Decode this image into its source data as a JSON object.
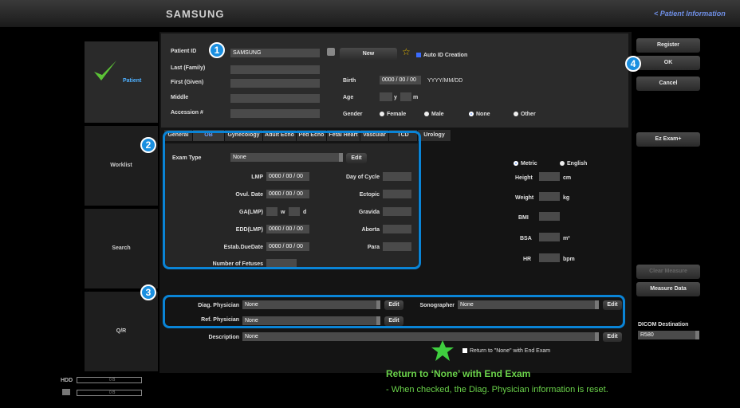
{
  "app": {
    "brand": "SAMSUNG",
    "back_link": "< Patient Information"
  },
  "sidebar": {
    "items": [
      {
        "label": "Patient"
      },
      {
        "label": "Worklist"
      },
      {
        "label": "Search"
      },
      {
        "label": "Q/R"
      }
    ]
  },
  "patient": {
    "labels": {
      "patient_id": "Patient ID",
      "last": "Last (Family)",
      "first": "First (Given)",
      "middle": "Middle",
      "accession": "Accession #",
      "birth": "Birth",
      "age": "Age",
      "gender": "Gender",
      "auto_id": "Auto ID Creation"
    },
    "patient_id_value": "SAMSUNG",
    "new_label": "New",
    "birth": {
      "yyyy": "0000",
      "mm": "00",
      "dd": "00",
      "sep": "/",
      "format": "YYYY/MM/DD"
    },
    "age_units": {
      "y": "y",
      "m": "m"
    },
    "genders": [
      "Female",
      "Male",
      "None",
      "Other"
    ]
  },
  "right_buttons": {
    "register": "Register",
    "ok": "OK",
    "cancel": "Cancel",
    "ez_exam": "Ez Exam+",
    "clear_measure": "Clear Measure",
    "measure_data": "Measure Data",
    "dicom_destination_label": "DICOM Destination",
    "dicom_destination_value": "R580"
  },
  "tabs": [
    {
      "label": "General"
    },
    {
      "label": "OB"
    },
    {
      "label": "Gynecology"
    },
    {
      "label": "Adult Echo"
    },
    {
      "label": "Ped Echo"
    },
    {
      "label": "Fetal Heart"
    },
    {
      "label": "Vascular"
    },
    {
      "label": "TCD"
    },
    {
      "label": "Urology"
    }
  ],
  "ob": {
    "exam_type_label": "Exam Type",
    "exam_type_value": "None",
    "edit": "Edit",
    "lmp": "LMP",
    "ovul_date": "Ovul. Date",
    "ga_lmp": "GA(LMP)",
    "edd_lmp": "EDD(LMP)",
    "estab_due": "Estab.DueDate",
    "number_of_fetuses": "Number of Fetuses",
    "date": {
      "yyyy": "0000",
      "mm": "00",
      "dd": "00",
      "sep": "/"
    },
    "w": "w",
    "d": "d",
    "day_of_cycle": "Day of Cycle",
    "ectopic": "Ectopic",
    "gravida": "Gravida",
    "aborta": "Aborta",
    "para": "Para"
  },
  "measures": {
    "metric": "Metric",
    "english": "English",
    "height": "Height",
    "cm": "cm",
    "weight": "Weight",
    "kg": "kg",
    "bmi": "BMI",
    "bsa": "BSA",
    "m2": "m²",
    "hr": "HR",
    "bpm": "bpm"
  },
  "physicians": {
    "diag_label": "Diag. Physician",
    "diag_value": "None",
    "ref_label": "Ref. Physician",
    "ref_value": "None",
    "sono_label": "Sonographer",
    "sono_value": "None",
    "desc_label": "Description",
    "desc_value": "None",
    "edit": "Edit",
    "return_none": "Return to \"None\" with End Exam"
  },
  "callouts": [
    "1",
    "2",
    "3",
    "4"
  ],
  "hdd": {
    "label": "HDD",
    "value1": "0 B",
    "value2": "0 B"
  },
  "note": {
    "title": "Return to ‘None’ with End Exam",
    "body": "-  When checked, the Diag. Physician information is reset."
  },
  "colors": {
    "accent": "#1a8fe0",
    "note": "#6ad14a",
    "link": "#6f8fe6"
  }
}
